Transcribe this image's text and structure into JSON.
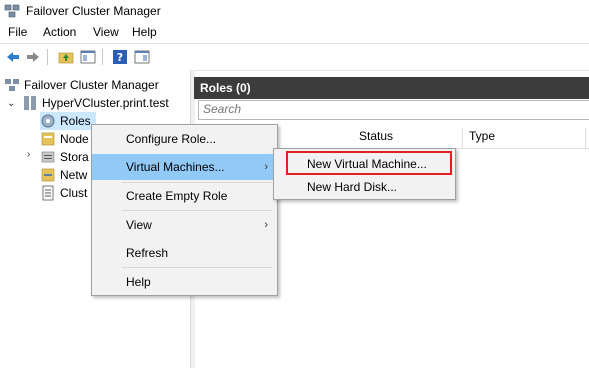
{
  "window": {
    "title": "Failover Cluster Manager"
  },
  "menubar": {
    "items": [
      "File",
      "Action",
      "View",
      "Help"
    ]
  },
  "toolbar": {
    "icons": [
      "back-arrow-icon",
      "forward-arrow-icon",
      "up-folder-icon",
      "show-hide-console-tree-icon",
      "help-icon",
      "action-pane-icon"
    ]
  },
  "tree": {
    "root": "Failover Cluster Manager",
    "cluster": "HyperVCluster.print.test",
    "items": [
      "Roles",
      "Node",
      "Stora",
      "Netw",
      "Clust"
    ]
  },
  "roles_pane": {
    "header": "Roles (0)",
    "search_placeholder": "Search",
    "columns": [
      "Status",
      "Type"
    ]
  },
  "context_menu": {
    "items": [
      "Configure Role...",
      "Virtual Machines...",
      "Create Empty Role",
      "View",
      "Refresh",
      "Help"
    ],
    "arrow": "›"
  },
  "submenu": {
    "items": [
      "New Virtual Machine...",
      "New Hard Disk..."
    ]
  },
  "colors": {
    "highlight": "#e02020",
    "hover": "#91c9f7",
    "header_bg": "#3c3c3c",
    "selection": "#cce8ff"
  }
}
